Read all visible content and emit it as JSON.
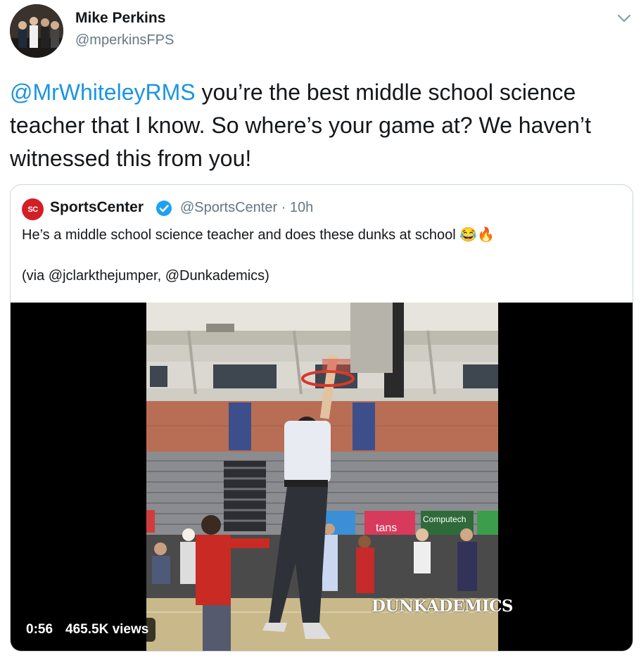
{
  "author": {
    "name": "Mike Perkins",
    "handle": "@mperkinsFPS",
    "avatar_icon": "profile-photo"
  },
  "tweet": {
    "mention": "@MrWhiteleyRMS",
    "text": " you’re the best middle school science teacher that I know. So where’s your game at? We haven’t witnessed this from you!"
  },
  "quoted": {
    "logo_text": "SC",
    "name": "SportsCenter",
    "handle": "@SportsCenter · 10h",
    "text": "He’s a middle school science teacher and does these dunks at school 😂🔥",
    "via": "(via @jclarkthejumper, @Dunkademics)",
    "video": {
      "watermark": "DUNKADEMICS",
      "duration": "0:56",
      "views": "465.5K views",
      "banner_text": "Computech",
      "sign_text": "tans"
    }
  },
  "colors": {
    "link": "#1b95e0",
    "secondary_text": "#657786",
    "verified": "#1da1f2",
    "espn_red": "#d21f26"
  }
}
